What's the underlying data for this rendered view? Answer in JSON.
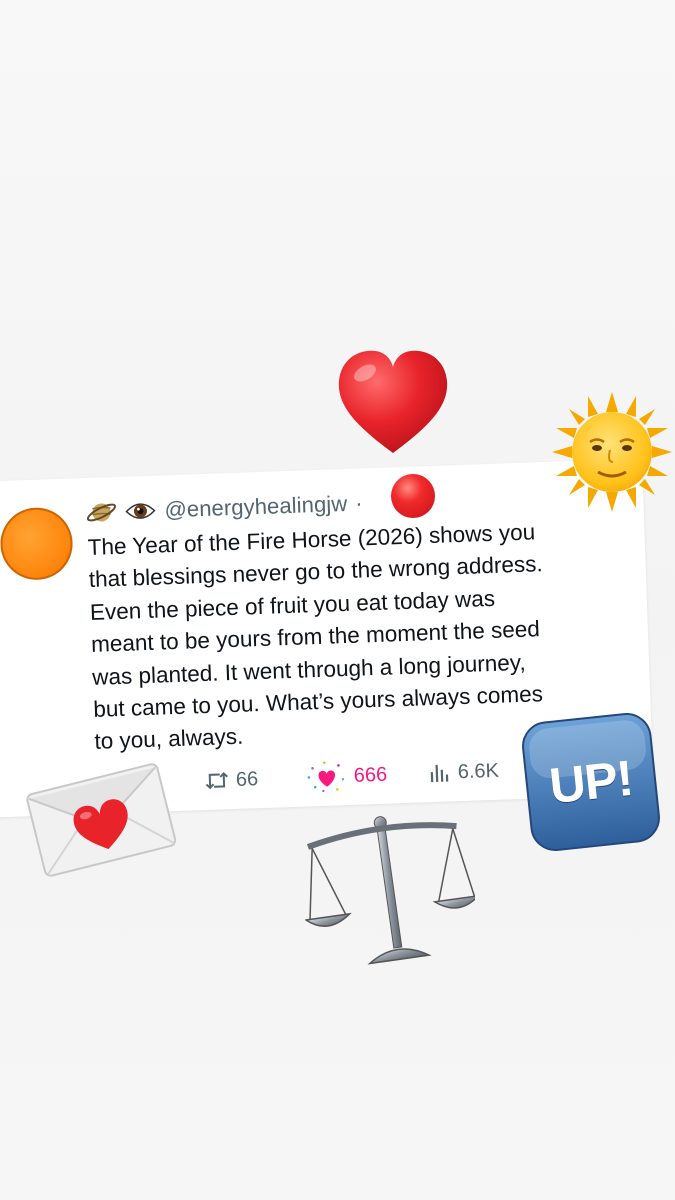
{
  "tweet": {
    "handle": "@energyhealingjw",
    "separator": "·",
    "header_icons": [
      "saturn-icon",
      "eye-icon"
    ],
    "text": "The Year of the Fire Horse (2026) shows you\nthat blessings never go to the wrong address.\nEven the piece of fruit you eat today was\nmeant to be yours from the moment the seed\nwas planted. It went through a long journey,\nbut came to you. What’s yours always comes\nto you, always.",
    "retweets": "66",
    "likes": "666",
    "views": "6.6K"
  },
  "stickers": {
    "up_text": "UP!",
    "items": [
      "red-heart-sticker",
      "red-circle-sticker",
      "sun-with-face-sticker",
      "love-letter-sticker",
      "up-button-sticker",
      "balance-scale-sticker"
    ]
  },
  "colors": {
    "like": "#f91880",
    "muted": "#536471",
    "text": "#0f1419",
    "avatar": "#ff8a12",
    "up_button": "#3f74b3"
  }
}
